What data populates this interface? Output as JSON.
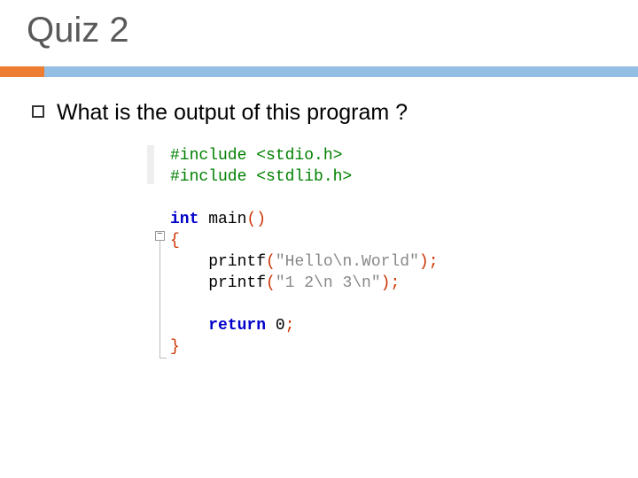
{
  "title": "Quiz 2",
  "question": "What is the output of this program ?",
  "code": {
    "l1_pp": "#include ",
    "l1_hdr": "<stdio.h>",
    "l2_pp": "#include ",
    "l2_hdr": "<stdlib.h>",
    "l4_kw": "int",
    "l4_fn": " main",
    "l4_par": "()",
    "l5_brace": "{",
    "l6_indent": "    printf",
    "l6_paren_open": "(",
    "l6_str": "\"Hello\\n.World\"",
    "l6_paren_close": ")",
    "l6_semi": ";",
    "l7_indent": "    printf",
    "l7_paren_open": "(",
    "l7_str": "\"1 2\\n 3\\n\"",
    "l7_paren_close": ")",
    "l7_semi": ";",
    "l9_indent": "    ",
    "l9_kw": "return",
    "l9_val": " 0",
    "l9_semi": ";",
    "l10_brace": "}"
  }
}
